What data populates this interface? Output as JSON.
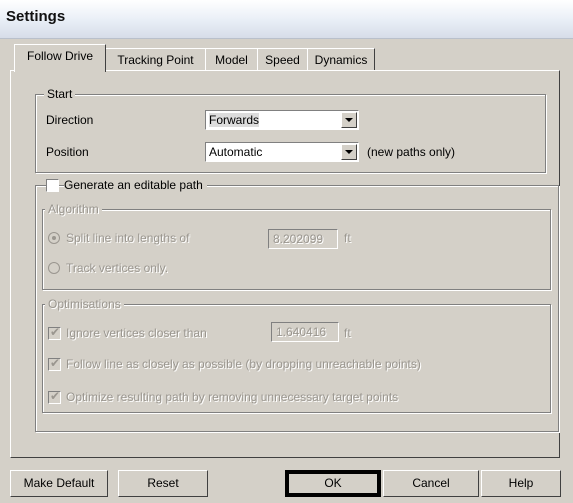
{
  "dialog": {
    "title": "Settings"
  },
  "tabs": [
    {
      "label": "Follow Drive",
      "active": true
    },
    {
      "label": "Tracking Point",
      "active": false
    },
    {
      "label": "Model",
      "active": false
    },
    {
      "label": "Speed",
      "active": false
    },
    {
      "label": "Dynamics",
      "active": false
    }
  ],
  "start": {
    "legend": "Start",
    "direction_label": "Direction",
    "direction_value": "Forwards",
    "position_label": "Position",
    "position_value": "Automatic",
    "position_note": "(new paths only)"
  },
  "editable_path": {
    "checkbox_label": "Generate an editable path",
    "checked": false
  },
  "algorithm": {
    "legend": "Algorithm",
    "split_label": "Split line into lengths of",
    "split_value": "8.202099",
    "split_unit": "ft",
    "track_label": "Track vertices only."
  },
  "optimisations": {
    "legend": "Optimisations",
    "ignore_label": "Ignore vertices closer than",
    "ignore_value": "1.640416",
    "ignore_unit": "ft",
    "follow_label": "Follow line as closely as possible (by dropping unreachable points)",
    "optimize_label": "Optimize resulting path by removing unnecessary target points"
  },
  "buttons": {
    "make_default": "Make Default",
    "reset": "Reset",
    "ok": "OK",
    "cancel": "Cancel",
    "help": "Help"
  }
}
